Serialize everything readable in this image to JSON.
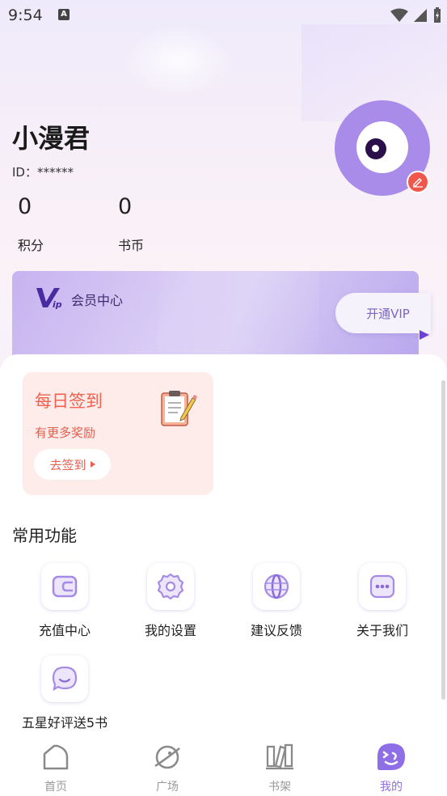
{
  "status_bar": {
    "time": "9:54",
    "notification_icon": "A"
  },
  "profile": {
    "username": "小漫君",
    "id_text": "ID：******",
    "stats": [
      {
        "value": "0",
        "label": "积分"
      },
      {
        "value": "0",
        "label": "书币"
      }
    ]
  },
  "vip": {
    "title": "会员中心",
    "button_label": "开通VIP"
  },
  "checkin": {
    "title": "每日签到",
    "subtitle": "有更多奖励",
    "button_label": "去签到"
  },
  "functions": {
    "section_title": "常用功能",
    "items": [
      {
        "label": "充值中心",
        "icon": "wallet-icon"
      },
      {
        "label": "我的设置",
        "icon": "gear-icon"
      },
      {
        "label": "建议反馈",
        "icon": "feedback-globe-icon"
      },
      {
        "label": "关于我们",
        "icon": "more-dots-icon"
      },
      {
        "label": "五星好评送5书",
        "icon": "chat-smile-icon"
      }
    ]
  },
  "bottom_nav": {
    "items": [
      {
        "label": "首页",
        "icon": "home-icon"
      },
      {
        "label": "广场",
        "icon": "planet-icon"
      },
      {
        "label": "书架",
        "icon": "bookshelf-icon"
      },
      {
        "label": "我的",
        "icon": "profile-face-icon"
      }
    ],
    "active_index": 3
  },
  "colors": {
    "accent_purple": "#8f6fe6",
    "checkin_red": "#f0614f",
    "edit_badge": "#f0574a"
  }
}
